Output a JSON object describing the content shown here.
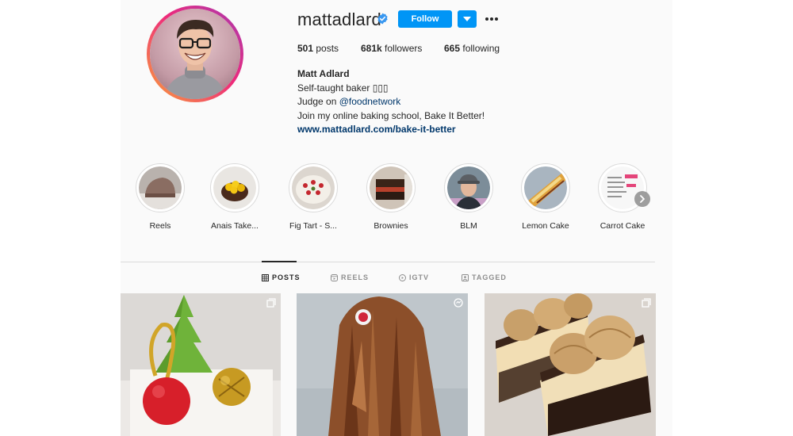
{
  "profile": {
    "username": "mattadlard",
    "follow_label": "Follow",
    "stats": {
      "posts_count": "501",
      "posts_label": "posts",
      "followers_count": "681k",
      "followers_label": "followers",
      "following_count": "665",
      "following_label": "following"
    },
    "bio": {
      "full_name": "Matt Adlard",
      "line1": "Self-taught baker ▯▯▯",
      "line2_prefix": "Judge on ",
      "line2_mention": "@foodnetwork",
      "line3": "Join my online baking school, Bake It Better!",
      "website": "www.mattadlard.com/bake-it-better"
    }
  },
  "highlights": [
    {
      "label": "Reels"
    },
    {
      "label": "Anais Take..."
    },
    {
      "label": "Fig Tart - S..."
    },
    {
      "label": "Brownies"
    },
    {
      "label": "BLM"
    },
    {
      "label": "Lemon Cake"
    },
    {
      "label": "Carrot Cake"
    }
  ],
  "tabs": [
    {
      "label": "POSTS",
      "icon": "grid-icon",
      "active": true
    },
    {
      "label": "REELS",
      "icon": "reels-icon",
      "active": false
    },
    {
      "label": "IGTV",
      "icon": "igtv-icon",
      "active": false
    },
    {
      "label": "TAGGED",
      "icon": "tagged-icon",
      "active": false
    }
  ],
  "posts": [
    {
      "subject": "christmas-tree-dessert",
      "overlay_icon": "carousel-icon"
    },
    {
      "subject": "chocolate-log",
      "overlay_icon": "reel-icon"
    },
    {
      "subject": "coffee-eclair-cake",
      "overlay_icon": "carousel-icon"
    }
  ],
  "colors": {
    "accent": "#0095f6",
    "verified": "#3897f0",
    "link": "#00376b",
    "text": "#262626",
    "muted": "#8e8e8e",
    "background": "#fafafa"
  }
}
